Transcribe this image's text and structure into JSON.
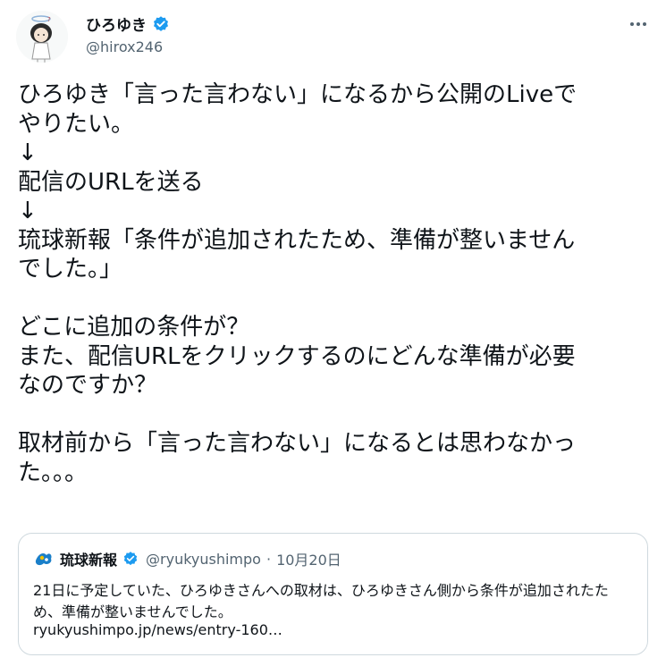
{
  "user": {
    "display_name": "ひろゆき",
    "handle": "@hirox246"
  },
  "tweet_text": "ひろゆき「言った言わない」になるから公開のLiveで\nやりたい。\n↓\n配信のURLを送る\n↓\n琉球新報「条件が追加されたため、準備が整いません\nでした。」\n\nどこに追加の条件が？\nまた、配信URLをクリックするのにどんな準備が必要\nなのですか？\n\n取材前から「言った言わない」になるとは思わなかっ\nた。。。",
  "quote": {
    "display_name": "琉球新報",
    "handle": "@ryukyushimpo",
    "separator": "·",
    "date": "10月20日",
    "text": "21日に予定していた、ひろゆきさんへの取材は、ひろゆきさん側から条件が追加されたため、準備が整いませんでした。",
    "link": "ryukyushimpo.jp/news/entry-160…"
  },
  "colors": {
    "verified": "#1d9bf0",
    "secondary_text": "#536471",
    "border": "#cfd9de"
  },
  "icons": [
    "avatar",
    "verified-badge-icon",
    "more-options-icon",
    "quote-avatar"
  ]
}
